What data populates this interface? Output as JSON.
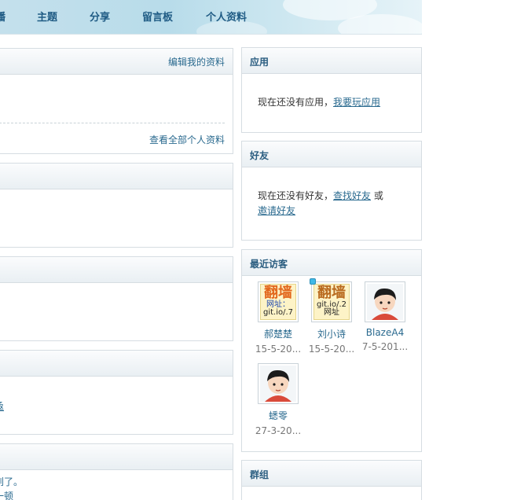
{
  "nav": {
    "items": [
      "播",
      "主题",
      "分享",
      "留言板",
      "个人资料"
    ]
  },
  "profile_panel": {
    "edit_link": "编辑我的资料",
    "view_all_link": "查看全部个人资料"
  },
  "partial_texts": {
    "line1": "亟",
    "line2": "到了。",
    "line3": "一顿"
  },
  "apps_panel": {
    "title": "应用",
    "empty_text": "现在还没有应用，",
    "link": "我要玩应用"
  },
  "friends_panel": {
    "title": "好友",
    "empty_text": "现在还没有好友，",
    "find_link": "查找好友",
    "or_text": " 或",
    "invite_link": "邀请好友"
  },
  "visitors_panel": {
    "title": "最近访客",
    "visitors": [
      {
        "name": "郝楚楚",
        "date": "15-5-20...",
        "avatar": "ad-image",
        "ad_lines": [
          "翻墙",
          "网址：",
          "git.io/.7"
        ]
      },
      {
        "name": "刘小诗",
        "date": "15-5-20...",
        "avatar": "ad-image",
        "ad_lines": [
          "翻墙",
          "git.io/.2",
          "网址"
        ]
      },
      {
        "name": "BlazeA4",
        "date": "7-5-201...",
        "avatar": "default-avatar"
      },
      {
        "name": "蟋零",
        "date": "27-3-20...",
        "avatar": "default-avatar"
      }
    ]
  },
  "groups_panel": {
    "title": "群组"
  },
  "colors": {
    "link": "#2a6a8f",
    "title": "#2a5d80",
    "nav": "#1f5b84",
    "border": "#d6dde2"
  }
}
